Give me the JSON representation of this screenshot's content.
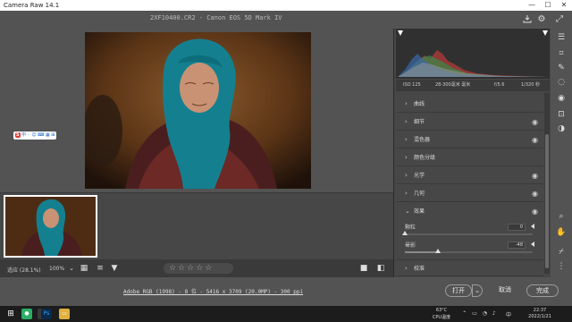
{
  "window": {
    "title": "Camera Raw 14.1",
    "controls": [
      "—",
      "☐",
      "✕"
    ]
  },
  "header": {
    "filename": "2XF10400.CR2  -  Canon EOS 5D Mark IV"
  },
  "histogram": {
    "iso": "ISO 125",
    "focal": "28-300毫米 毫米",
    "aperture": "f/5.6",
    "shutter": "1/320 秒"
  },
  "panel": {
    "sections": [
      {
        "label": "曲线",
        "expanded": false
      },
      {
        "label": "细节",
        "expanded": false
      },
      {
        "label": "混色器",
        "expanded": false
      },
      {
        "label": "颜色分级",
        "expanded": false
      },
      {
        "label": "光学",
        "expanded": false
      },
      {
        "label": "几何",
        "expanded": false
      },
      {
        "label": "效果",
        "expanded": true
      },
      {
        "label": "校准",
        "expanded": false
      }
    ],
    "effects": {
      "grain_label": "颗粒",
      "grain_value": "0",
      "vignette_label": "晕影",
      "vignette_value": "-48",
      "grain_fraction": 0.0,
      "vignette_fraction": 0.26
    }
  },
  "bottombar": {
    "fit_label": "适应 (28.1%)",
    "zoom_select": "100%",
    "stars": "☆☆☆☆☆"
  },
  "infobar": {
    "file_info": "Adobe RGB (1998) - 8 位 - 5416 x 3709 (20.0MP) - 300 ppi",
    "open_button": "打开",
    "cancel_button": "取消",
    "done_button": "完成"
  },
  "ime": {
    "logo": "S",
    "items": "中 ◦ ☺ ⌨ ▦ ⊞"
  },
  "taskbar": {
    "weather_temp": "63°C",
    "weather_label": "CPU温度",
    "time": "22:37",
    "date": "2022/1/21",
    "ps_label": "Ps",
    "ime_lang": "中"
  },
  "colors": {
    "accent": "#1e88a8",
    "panel_bg": "#474747",
    "canvas_bg": "#535353"
  }
}
